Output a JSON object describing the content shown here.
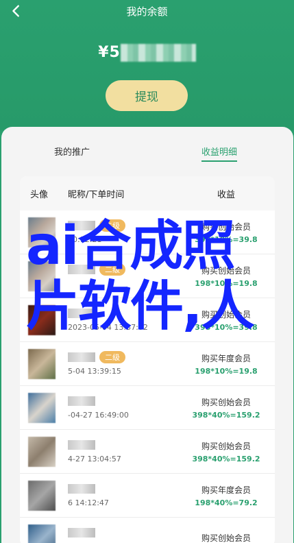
{
  "header": {
    "title": "我的余额",
    "balance_prefix": "¥",
    "balance_visible": "5",
    "withdraw_label": "提现"
  },
  "tabs": [
    {
      "label": "我的推广",
      "active": false
    },
    {
      "label": "收益明细",
      "active": true
    }
  ],
  "table": {
    "columns": [
      "头像",
      "昵称/下单时间",
      "收益"
    ],
    "rows": [
      {
        "badge": "二级",
        "time": "10:12:21",
        "desc": "购买创始会员",
        "calc": "398*10%=39.8"
      },
      {
        "badge": "二级",
        "time": "",
        "desc": "购买创始会员",
        "calc": "198*10%=19.8"
      },
      {
        "badge": "",
        "time": "2023-05-04 13:37:02",
        "desc": "购买创始会员",
        "calc": "398*10%=39.8"
      },
      {
        "badge": "二级",
        "time": "5-04 13:39:15",
        "desc": "购买年度会员",
        "calc": "198*10%=19.8"
      },
      {
        "badge": "",
        "time": "-04-27 16:49:00",
        "desc": "购买创始会员",
        "calc": "398*40%=159.2"
      },
      {
        "badge": "",
        "time": "4-27 13:04:57",
        "desc": "购买创始会员",
        "calc": "398*40%=159.2"
      },
      {
        "badge": "",
        "time": "6 14:12:47",
        "desc": "购买年度会员",
        "calc": "198*40%=79.2"
      },
      {
        "badge": "",
        "time": "",
        "desc": "购买创始会员",
        "calc": ""
      }
    ]
  },
  "watermark": {
    "line1": "ai合成照",
    "line2": "片软件,人"
  },
  "colors": {
    "brand_green": "#2aa06f",
    "button_gold": "#f2dfa0",
    "badge_orange": "#f0b95e",
    "watermark_blue": "#1426ff"
  },
  "icons": {
    "back": "chevron-left-icon"
  }
}
